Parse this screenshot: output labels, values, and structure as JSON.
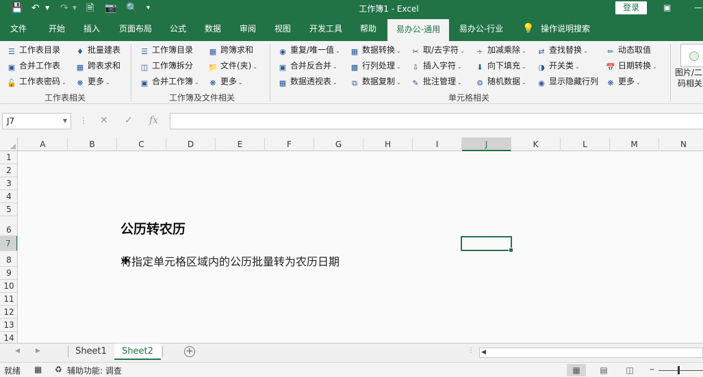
{
  "window": {
    "title": "工作簿1  -  Excel",
    "login_label": "登录",
    "accent_color": "#217346"
  },
  "tabs": [
    "文件",
    "开始",
    "插入",
    "页面布局",
    "公式",
    "数据",
    "审阅",
    "视图",
    "开发工具",
    "帮助",
    "易办公-通用",
    "易办公-行业",
    "操作说明搜索"
  ],
  "active_tab": "易办公-通用",
  "ribbon": {
    "g1": {
      "items": [
        "工作表目录",
        "合并工作表",
        "工作表密码",
        "批量建表",
        "跨表求和",
        "更多"
      ],
      "label": "工作表相关"
    },
    "g2": {
      "items": [
        "工作簿目录",
        "工作簿拆分",
        "合并工作簿",
        "跨簿求和",
        "文件(夹)",
        "更多"
      ],
      "label": "工作簿及文件相关"
    },
    "g3": {
      "items": [
        "重复/唯一值",
        "合并反合并",
        "数据透视表",
        "数据转换",
        "行列处理",
        "数据复制",
        "取/去字符",
        "插入字符",
        "批注管理",
        "加减乘除",
        "向下填充",
        "随机数据",
        "查找替换",
        "开关类",
        "显示隐藏行列",
        "动态取值",
        "日期转换",
        "更多"
      ],
      "label": "单元格相关"
    },
    "g4": {
      "line1": "图片/二",
      "line2": "码相关"
    }
  },
  "formula_bar": {
    "name_box": "J7",
    "fx_label": "fx",
    "value": ""
  },
  "grid": {
    "columns": [
      "A",
      "B",
      "C",
      "D",
      "E",
      "F",
      "G",
      "H",
      "I",
      "J",
      "K",
      "L",
      "M",
      "N"
    ],
    "rows": [
      "1",
      "2",
      "3",
      "4",
      "5",
      "6",
      "7",
      "8",
      "9",
      "10",
      "11",
      "12",
      "13",
      "14"
    ],
    "selected_cell": "J7",
    "cells": {
      "C6": "公历转农历",
      "C8": "将指定单元格区域内的公历批量转为农历日期"
    }
  },
  "sheet_tabs": {
    "tabs": [
      "Sheet1",
      "Sheet2"
    ],
    "active": "Sheet2"
  },
  "status_bar": {
    "ready": "就绪",
    "accessibility": "辅助功能: 调查"
  }
}
